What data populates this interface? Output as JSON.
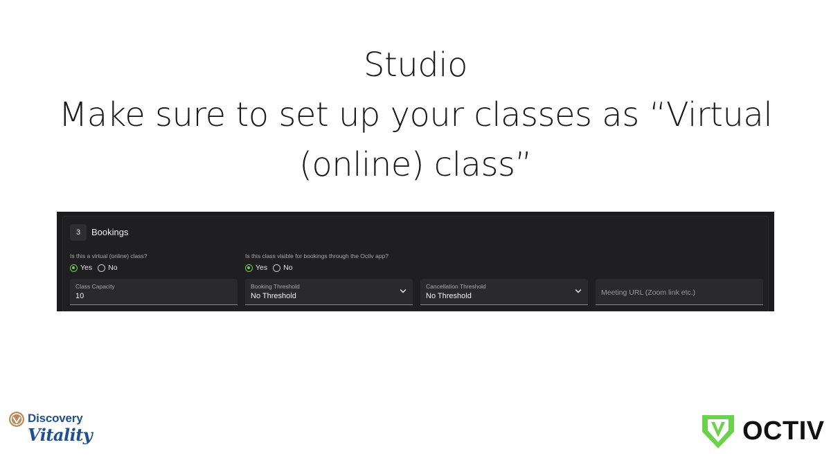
{
  "slide": {
    "title_line1": "Studio",
    "title_line2": "Make sure to set up your classes as “Virtual",
    "title_line3": "(online) class”"
  },
  "bookings": {
    "step_number": "3",
    "section_title": "Bookings",
    "virtual_question": {
      "label": "Is this a virtual (online) class?",
      "yes_label": "Yes",
      "no_label": "No",
      "selected": "Yes"
    },
    "visible_question": {
      "label": "Is this class visible for bookings through the Octiv app?",
      "yes_label": "Yes",
      "no_label": "No",
      "selected": "Yes"
    },
    "class_capacity": {
      "label": "Class Capacity",
      "value": "10"
    },
    "booking_threshold": {
      "label": "Booking Threshold",
      "value": "No Threshold"
    },
    "cancellation_threshold": {
      "label": "Cancellation Threshold",
      "value": "No Threshold"
    },
    "meeting_url": {
      "placeholder": "Meeting URL (Zoom link etc.)",
      "value": ""
    }
  },
  "logos": {
    "discovery_line1": "Discovery",
    "discovery_line2": "Vitality",
    "octiv": "OCTIV"
  },
  "colors": {
    "accent_green": "#6cd14b",
    "panel_bg": "#1c1c1e",
    "field_bg": "#2a2a2d",
    "discovery_blue": "#1f4f8f"
  },
  "icons": {
    "radio_selected": "radio-checked-icon",
    "radio_unselected": "radio-unchecked-icon",
    "dropdown": "chevron-down-icon"
  }
}
